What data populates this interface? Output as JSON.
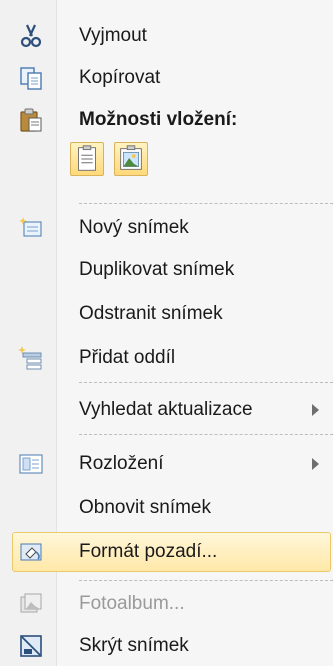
{
  "menu": {
    "cut": "Vyjmout",
    "copy": "Kopírovat",
    "paste_options": "Možnosti vložení:",
    "new_slide": "Nový snímek",
    "duplicate_slide": "Duplikovat snímek",
    "delete_slide": "Odstranit snímek",
    "add_section": "Přidat oddíl",
    "check_updates": "Vyhledat aktualizace",
    "layout": "Rozložení",
    "reset_slide": "Obnovit snímek",
    "format_background": "Formát pozadí...",
    "photo_album": "Fotoalbum...",
    "hide_slide": "Skrýt snímek"
  },
  "icons": {
    "cut": "scissors-icon",
    "copy": "copy-icon",
    "paste": "clipboard-icon",
    "paste_keep_source": "paste-keep-text-icon",
    "paste_picture": "paste-picture-icon",
    "new_slide": "new-slide-icon",
    "add_section": "add-section-icon",
    "layout": "layout-icon",
    "format_background": "format-background-icon",
    "photo_album": "photo-album-icon",
    "hide_slide": "hide-slide-icon"
  },
  "colors": {
    "highlight_border": "#e9c96a",
    "highlight_fill": "#ffe8a8",
    "disabled_text": "#9a9a9a"
  }
}
